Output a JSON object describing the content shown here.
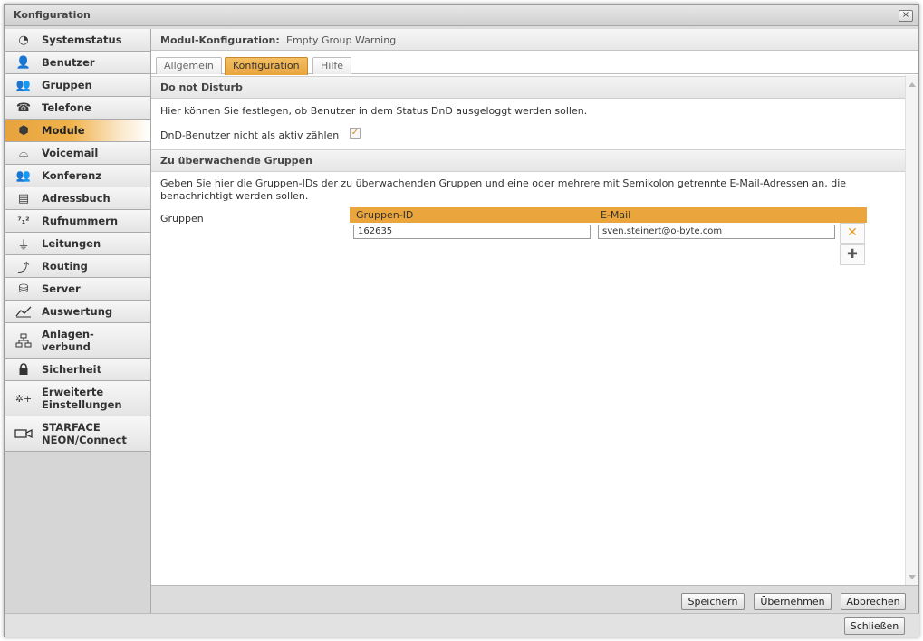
{
  "window": {
    "title": "Konfiguration",
    "close_symbol": "×"
  },
  "sidebar": {
    "items": [
      {
        "label": "Systemstatus",
        "icon": "pie-chart-icon",
        "glyph": "◔"
      },
      {
        "label": "Benutzer",
        "icon": "user-icon",
        "glyph": "👤"
      },
      {
        "label": "Gruppen",
        "icon": "group-icon",
        "glyph": "👥"
      },
      {
        "label": "Telefone",
        "icon": "phone-icon",
        "glyph": "☎"
      },
      {
        "label": "Module",
        "icon": "cube-icon",
        "glyph": "⬢",
        "active": true
      },
      {
        "label": "Voicemail",
        "icon": "voicemail-icon",
        "glyph": "⌓"
      },
      {
        "label": "Konferenz",
        "icon": "conference-icon",
        "glyph": "👥"
      },
      {
        "label": "Adressbuch",
        "icon": "addressbook-icon",
        "glyph": "▤"
      },
      {
        "label": "Rufnummern",
        "icon": "numbers-icon",
        "glyph": "⁷₁²"
      },
      {
        "label": "Leitungen",
        "icon": "plug-icon",
        "glyph": "⏚"
      },
      {
        "label": "Routing",
        "icon": "routing-icon",
        "glyph": "⤴"
      },
      {
        "label": "Server",
        "icon": "server-icon",
        "glyph": "⛁"
      },
      {
        "label": "Auswertung",
        "icon": "line-chart-icon",
        "glyph": "📈"
      },
      {
        "label": "Anlagen-\nverbund",
        "icon": "network-icon",
        "glyph": "⛓"
      },
      {
        "label": "Sicherheit",
        "icon": "lock-icon",
        "glyph": "🔒"
      },
      {
        "label": "Erweiterte\nEinstellungen",
        "icon": "gears-icon",
        "glyph": "✲+"
      },
      {
        "label": "STARFACE\nNEON/Connect",
        "icon": "camera-icon",
        "glyph": "▭◂"
      }
    ]
  },
  "header": {
    "key": "Modul-Konfiguration:",
    "value": "Empty Group Warning"
  },
  "tabs": [
    {
      "label": "Allgemein",
      "active": false
    },
    {
      "label": "Konfiguration",
      "active": true
    },
    {
      "label": "Hilfe",
      "active": false
    }
  ],
  "dnd": {
    "heading": "Do not Disturb",
    "description": "Hier können Sie festlegen, ob Benutzer in dem Status DnD ausgeloggt werden sollen.",
    "checkbox_label": "DnD-Benutzer nicht als aktiv zählen",
    "checkbox_checked": true,
    "check_glyph": "✓"
  },
  "groups": {
    "heading": "Zu überwachende Gruppen",
    "description": "Geben Sie hier die Gruppen-IDs der zu überwachenden Gruppen und eine oder mehrere mit Semikolon getrennte E-Mail-Adressen an, die benachrichtigt werden sollen.",
    "field_label": "Gruppen",
    "columns": [
      "Gruppen-ID",
      "E-Mail"
    ],
    "rows": [
      {
        "group_id": "162635",
        "email": "sven.steinert@o-byte.com"
      }
    ],
    "delete_glyph": "✕",
    "add_glyph": "✚"
  },
  "footer": {
    "save": "Speichern",
    "apply": "Übernehmen",
    "cancel": "Abbrechen"
  },
  "bottom": {
    "close": "Schließen"
  },
  "colors": {
    "accent": "#eba53d",
    "accent_dark": "#c8892d"
  }
}
